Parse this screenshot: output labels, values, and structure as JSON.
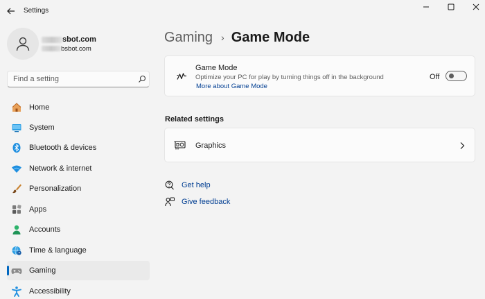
{
  "window": {
    "title": "Settings"
  },
  "user": {
    "name": "sbot.com",
    "email": "bsbot.com"
  },
  "search": {
    "placeholder": "Find a setting"
  },
  "sidebar": {
    "items": [
      {
        "label": "Home",
        "icon": "home-icon"
      },
      {
        "label": "System",
        "icon": "system-icon"
      },
      {
        "label": "Bluetooth & devices",
        "icon": "bluetooth-icon"
      },
      {
        "label": "Network & internet",
        "icon": "wifi-icon"
      },
      {
        "label": "Personalization",
        "icon": "brush-icon"
      },
      {
        "label": "Apps",
        "icon": "apps-icon"
      },
      {
        "label": "Accounts",
        "icon": "person-icon"
      },
      {
        "label": "Time & language",
        "icon": "globe-clock-icon"
      },
      {
        "label": "Gaming",
        "icon": "gamepad-icon",
        "active": true
      },
      {
        "label": "Accessibility",
        "icon": "accessibility-icon"
      }
    ]
  },
  "breadcrumb": {
    "parent": "Gaming",
    "separator": "›",
    "current": "Game Mode"
  },
  "game_mode": {
    "title": "Game Mode",
    "description": "Optimize your PC for play by turning things off in the background",
    "link": "More about Game Mode",
    "state_label": "Off",
    "enabled": false
  },
  "related": {
    "heading": "Related settings",
    "items": [
      {
        "label": "Graphics",
        "icon": "display-adapter-icon"
      }
    ]
  },
  "help": {
    "get_help": "Get help",
    "give_feedback": "Give feedback"
  },
  "colors": {
    "accent": "#0067c0",
    "link": "#003e92",
    "background": "#f3f3f3",
    "card": "#fbfbfb"
  }
}
